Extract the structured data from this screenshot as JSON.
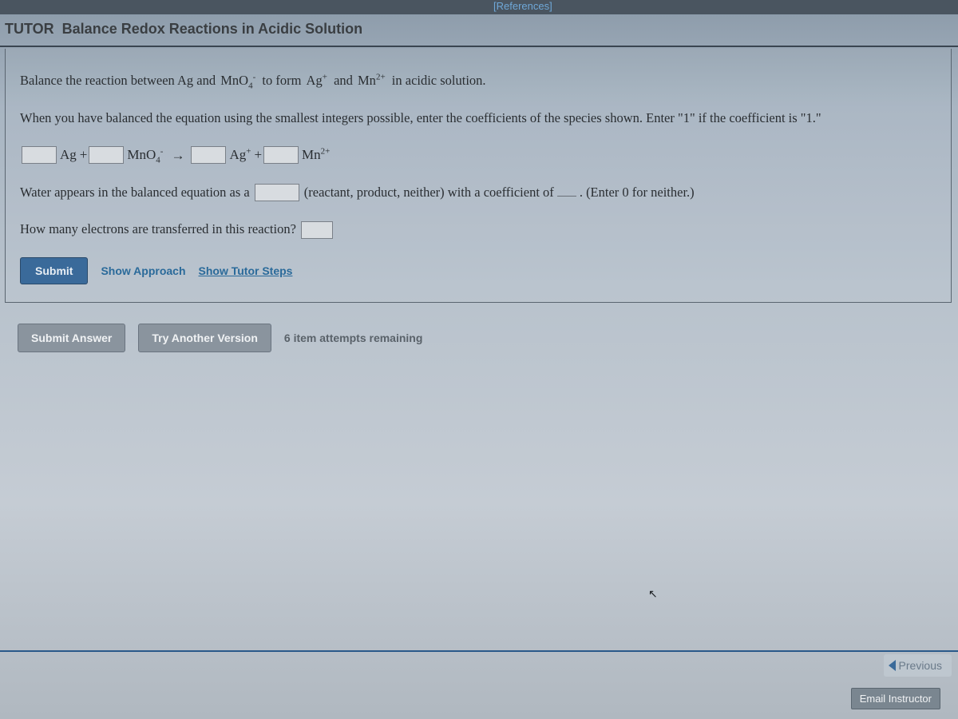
{
  "topbar": {
    "references": "[References]"
  },
  "header": {
    "tutor": "TUTOR",
    "title": "Balance Redox Reactions in Acidic Solution"
  },
  "content": {
    "instruction1_pre": "Balance the reaction between Ag and ",
    "species_mno4": "MnO",
    "instruction1_mid": " to form ",
    "species_ag_plus": "Ag",
    "instruction1_and": " and ",
    "species_mn2": "Mn",
    "instruction1_end": " in acidic solution.",
    "instruction2": "When you have balanced the equation using the smallest integers possible, enter the coefficients of the species shown. Enter \"1\" if the coefficient is \"1.\"",
    "eq_ag": "Ag",
    "eq_plus": "+",
    "eq_mno4": "MnO",
    "eq_arrow": "→",
    "eq_agplus": "Ag",
    "eq_plus2": "+",
    "eq_mn2": "Mn",
    "water_pre": "Water appears in the balanced equation as a",
    "water_mid": "(reactant, product, neither) with a coefficient of",
    "water_end": ". (Enter 0 for neither.)",
    "electrons": "How many electrons are transferred in this reaction?"
  },
  "buttons": {
    "submit": "Submit",
    "show_approach": "Show Approach",
    "show_tutor_steps": "Show Tutor Steps",
    "submit_answer": "Submit Answer",
    "try_another": "Try Another Version",
    "attempts": "6 item attempts remaining",
    "previous": "Previous",
    "email": "Email Instructor"
  }
}
